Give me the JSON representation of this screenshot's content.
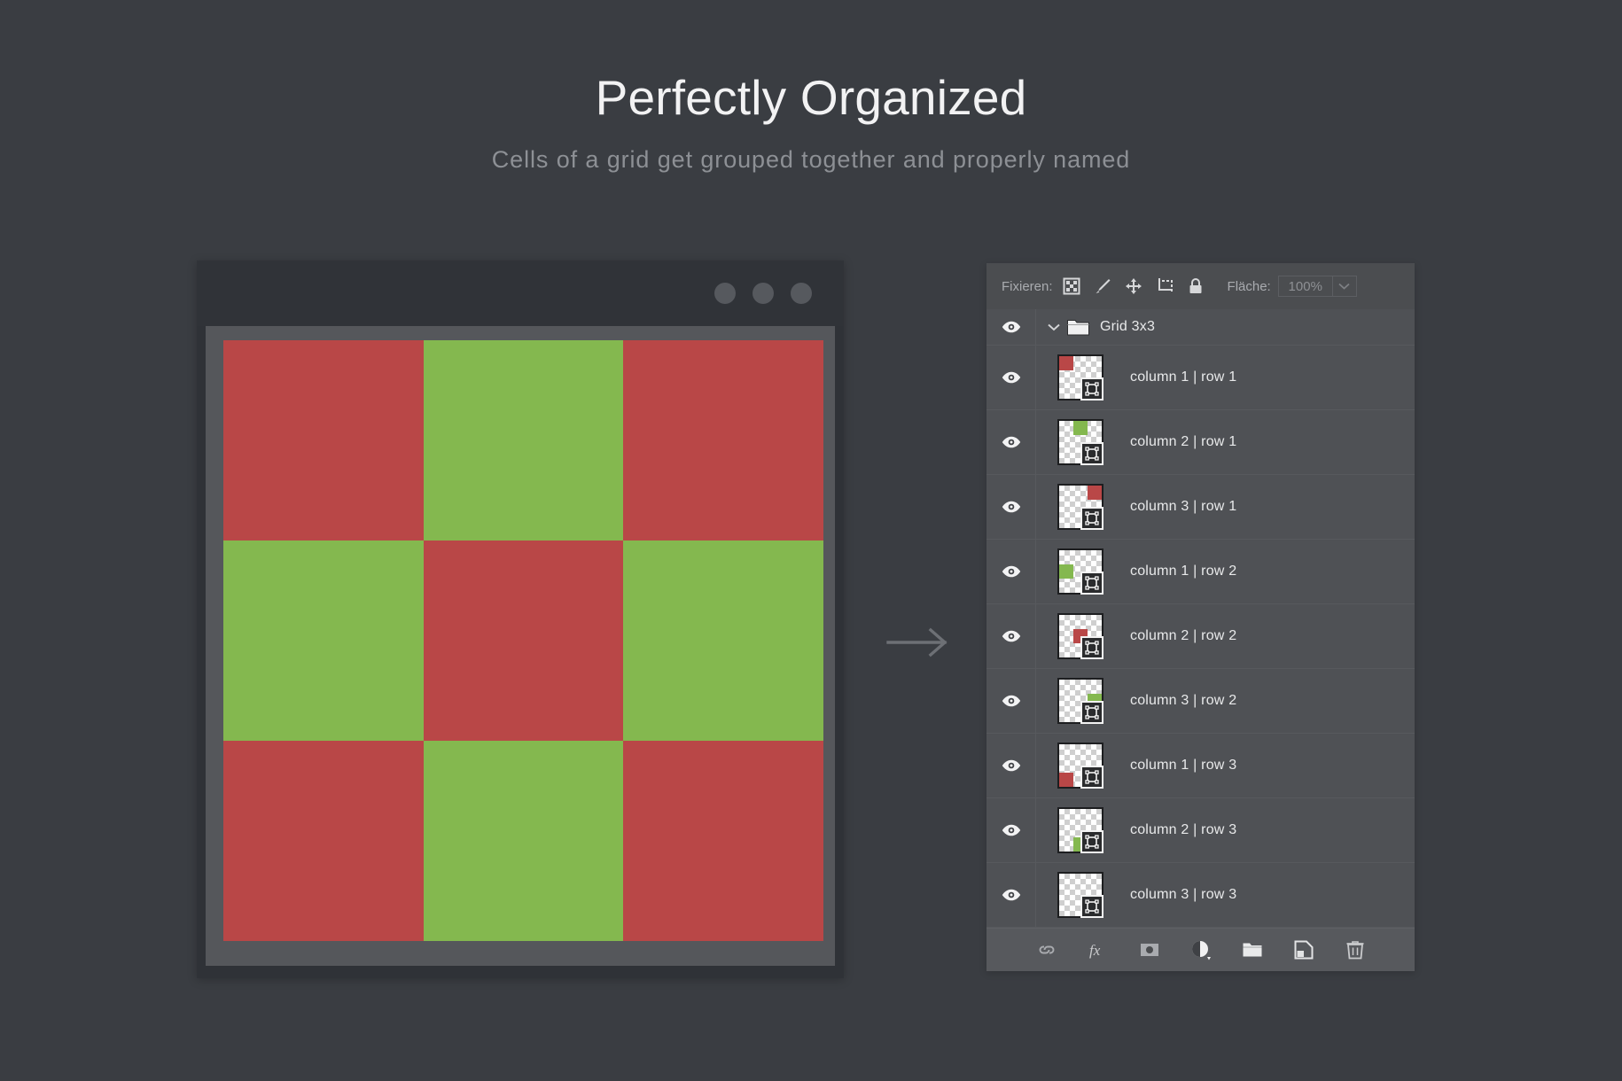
{
  "heading": {
    "title": "Perfectly Organized",
    "subtitle": "Cells of a grid get grouped together and properly named"
  },
  "colors": {
    "background": "#3a3d42",
    "red": "#b94747",
    "green": "#84b84f",
    "panel": "#4f5155",
    "panel_header": "#4b4d50",
    "panel_footer": "#57595d",
    "row_divider": "#57595d",
    "text_primary": "#e8e9ea",
    "text_muted": "#a9abaf",
    "title_color": "#f2f2f3",
    "subtitle_color": "#8d9095"
  },
  "browser_mockup": {
    "name": "browser-window-mockup",
    "dots": [
      "dot-1",
      "dot-2",
      "dot-3"
    ],
    "grid": {
      "columns": 3,
      "rows": 3,
      "cells": [
        {
          "label": "column 1 | row 1",
          "color": "#b94747"
        },
        {
          "label": "column 2 | row 1",
          "color": "#84b84f"
        },
        {
          "label": "column 3 | row 1",
          "color": "#b94747"
        },
        {
          "label": "column 1 | row 2",
          "color": "#84b84f"
        },
        {
          "label": "column 2 | row 2",
          "color": "#b94747"
        },
        {
          "label": "column 3 | row 2",
          "color": "#84b84f"
        },
        {
          "label": "column 1 | row 3",
          "color": "#b94747"
        },
        {
          "label": "column 2 | row 3",
          "color": "#84b84f"
        },
        {
          "label": "column 3 | row 3",
          "color": "#b94747"
        }
      ]
    }
  },
  "arrow": {
    "icon": "arrow-right-icon"
  },
  "layers_panel": {
    "header": {
      "lock_label": "Fixieren:",
      "lock_icons": [
        "lock-transparent-pixels-icon",
        "lock-image-pixels-icon",
        "lock-position-icon",
        "lock-artboard-nesting-icon",
        "lock-all-icon"
      ],
      "fill_label": "Fläche:",
      "fill_value": "100%",
      "fill_dropdown_icon": "chevron-down-icon"
    },
    "group": {
      "name": "Grid 3x3",
      "visible_icon": "eye-icon",
      "expand_icon": "chevron-down-icon",
      "folder_icon": "folder-icon",
      "expanded": true
    },
    "layers": [
      {
        "name": "column 1 | row 1",
        "color": "#b94747",
        "col": 1,
        "row": 1,
        "visible_icon": "eye-icon",
        "badge": "smart-object-icon"
      },
      {
        "name": "column 2 | row 1",
        "color": "#84b84f",
        "col": 2,
        "row": 1,
        "visible_icon": "eye-icon",
        "badge": "smart-object-icon"
      },
      {
        "name": "column 3 | row 1",
        "color": "#b94747",
        "col": 3,
        "row": 1,
        "visible_icon": "eye-icon",
        "badge": "smart-object-icon"
      },
      {
        "name": "column 1 | row 2",
        "color": "#84b84f",
        "col": 1,
        "row": 2,
        "visible_icon": "eye-icon",
        "badge": "smart-object-icon"
      },
      {
        "name": "column 2 | row 2",
        "color": "#b94747",
        "col": 2,
        "row": 2,
        "visible_icon": "eye-icon",
        "badge": "smart-object-icon"
      },
      {
        "name": "column 3 | row 2",
        "color": "#84b84f",
        "col": 3,
        "row": 2,
        "visible_icon": "eye-icon",
        "badge": "smart-object-icon"
      },
      {
        "name": "column 1 | row 3",
        "color": "#b94747",
        "col": 1,
        "row": 3,
        "visible_icon": "eye-icon",
        "badge": "smart-object-icon"
      },
      {
        "name": "column 2 | row 3",
        "color": "#84b84f",
        "col": 2,
        "row": 3,
        "visible_icon": "eye-icon",
        "badge": "smart-object-icon"
      },
      {
        "name": "column 3 | row 3",
        "color": "#b94747",
        "col": 3,
        "row": 3,
        "visible_icon": "eye-icon",
        "badge": "smart-object-icon"
      }
    ],
    "footer_buttons": [
      {
        "name": "link-layers-button",
        "icon": "link-icon"
      },
      {
        "name": "layer-style-button",
        "icon": "fx-icon"
      },
      {
        "name": "add-layer-mask-button",
        "icon": "layer-mask-icon"
      },
      {
        "name": "new-adjustment-layer-button",
        "icon": "adjustment-layer-icon"
      },
      {
        "name": "new-group-button",
        "icon": "folder-icon"
      },
      {
        "name": "new-layer-button",
        "icon": "new-layer-icon"
      },
      {
        "name": "delete-layer-button",
        "icon": "trash-icon"
      }
    ]
  }
}
